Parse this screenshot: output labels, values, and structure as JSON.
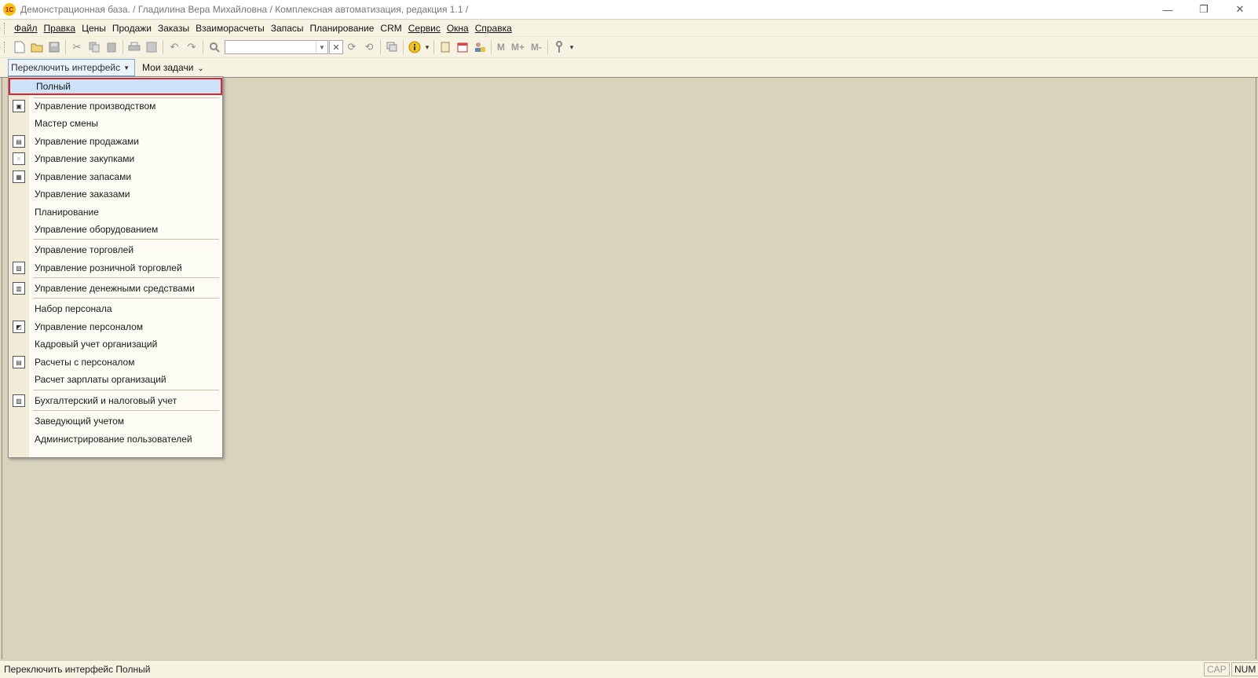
{
  "window": {
    "logo_text": "1С",
    "title": "Демонстрационная база. / Гладилина Вера Михайловна /  Комплексная автоматизация, редакция 1.1 /",
    "minimize_glyph": "—",
    "restore_glyph": "❐",
    "close_glyph": "✕"
  },
  "menubar": {
    "items": [
      {
        "label": "Файл"
      },
      {
        "label": "Правка"
      },
      {
        "label": "Цены"
      },
      {
        "label": "Продажи"
      },
      {
        "label": "Заказы"
      },
      {
        "label": "Взаиморасчеты"
      },
      {
        "label": "Запасы"
      },
      {
        "label": "Планирование"
      },
      {
        "label": "CRM"
      },
      {
        "label": "Сервис"
      },
      {
        "label": "Окна"
      },
      {
        "label": "Справка"
      }
    ]
  },
  "toolbar": {
    "search_value": "",
    "m_label": "M",
    "mplus_label": "M+",
    "mminus_label": "M-"
  },
  "panel": {
    "switch_label": "Переключить интерфейс",
    "tasks_label": "Мои задачи"
  },
  "interface_menu": {
    "items": [
      {
        "label": "Полный",
        "selected": true,
        "icon": "none"
      },
      {
        "label": "Управление производством",
        "icon": "production-icon"
      },
      {
        "label": "Мастер смены",
        "icon": "none"
      },
      {
        "label": "Управление продажами",
        "icon": "sales-icon"
      },
      {
        "label": "Управление закупками",
        "icon": "purchases-icon"
      },
      {
        "label": "Управление запасами",
        "icon": "inventory-icon"
      },
      {
        "label": "Управление заказами",
        "icon": "none"
      },
      {
        "label": "Планирование",
        "icon": "none"
      },
      {
        "label": "Управление оборудованием",
        "icon": "none"
      },
      {
        "label": "Управление торговлей",
        "icon": "none"
      },
      {
        "label": "Управление розничной торговлей",
        "icon": "retail-icon"
      },
      {
        "label": "Управление денежными средствами",
        "icon": "cash-icon"
      },
      {
        "label": "Набор персонала",
        "icon": "none"
      },
      {
        "label": "Управление персоналом",
        "icon": "personnel-icon"
      },
      {
        "label": "Кадровый учет организаций",
        "icon": "none"
      },
      {
        "label": "Расчеты с персоналом",
        "icon": "payroll-icon"
      },
      {
        "label": "Расчет зарплаты организаций",
        "icon": "none"
      },
      {
        "label": "Бухгалтерский и налоговый учет",
        "icon": "accounting-icon"
      },
      {
        "label": "Заведующий учетом",
        "icon": "none"
      },
      {
        "label": "Администрирование пользователей",
        "icon": "none"
      }
    ]
  },
  "statusbar": {
    "text": "Переключить интерфейс Полный",
    "cap": "CAP",
    "num": "NUM"
  }
}
